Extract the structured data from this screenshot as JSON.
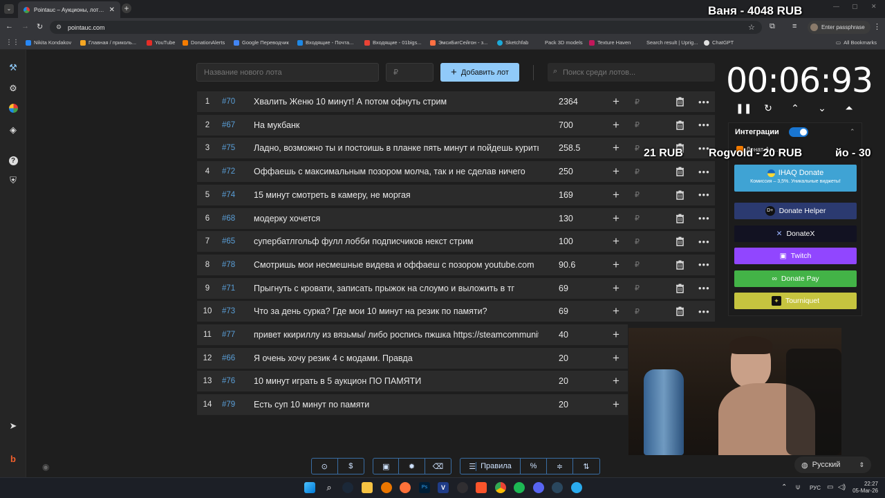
{
  "browser": {
    "tab_title": "Pointauc – Аукционы, лотереи",
    "url": "pointauc.com",
    "profile_label": "Enter passphrase",
    "bookmarks": [
      "Nikita Kondakov",
      "Главная / приколь...",
      "YouTube",
      "DonationAlerts",
      "Google Переводчик",
      "Входящие - Почта...",
      "Входящие - 01bigs...",
      "ЭмсиБигСейгон - з...",
      "Sketchfab",
      "Pack 3D models",
      "Texture Haven",
      "Search result | Uprig...",
      "ChatGPT"
    ],
    "all_bookmarks": "All Bookmarks"
  },
  "toolbar": {
    "new_lot_placeholder": "Название нового лота",
    "amount_placeholder": "₽",
    "add_button": "Добавить лот",
    "search_placeholder": "Поиск среди лотов..."
  },
  "lots": [
    {
      "rank": "1",
      "id": "#70",
      "name": "Хвалить Женю 10 минут! А потом офнуть стрим",
      "amount": "2364"
    },
    {
      "rank": "2",
      "id": "#67",
      "name": "На мукбанк",
      "amount": "700"
    },
    {
      "rank": "3",
      "id": "#75",
      "name": "Ладно, возможно ты и постоишь в планке пять минут и пойдешь курить",
      "amount": "258.5"
    },
    {
      "rank": "4",
      "id": "#72",
      "name": "Оффаешь с максимальным позором молча, так и не сделав ничего",
      "amount": "250"
    },
    {
      "rank": "5",
      "id": "#74",
      "name": "15 минут смотреть в камеру, не моргая",
      "amount": "169"
    },
    {
      "rank": "6",
      "id": "#68",
      "name": "модерку хочется",
      "amount": "130"
    },
    {
      "rank": "7",
      "id": "#65",
      "name": "супербатлгольф фулл лобби подписчиков некст стрим",
      "amount": "100"
    },
    {
      "rank": "8",
      "id": "#78",
      "name": "Смотришь мои несмешные видева и оффаеш с позором youtube.com",
      "amount": "90.6"
    },
    {
      "rank": "9",
      "id": "#71",
      "name": "Прыгнуть с кровати, записать прыжок на слоумо и выложить в тг",
      "amount": "69"
    },
    {
      "rank": "10",
      "id": "#73",
      "name": "Что за день сурка? Где мои 10 минут на резик по памяти?",
      "amount": "69"
    },
    {
      "rank": "11",
      "id": "#77",
      "name": "привет ккириллу из вязьмы/ либо роспись пжшка https://steamcommunity",
      "amount": "40"
    },
    {
      "rank": "12",
      "id": "#66",
      "name": "Я очень хочу резик 4 с модами. Правда",
      "amount": "20"
    },
    {
      "rank": "13",
      "id": "#76",
      "name": "10 минут играть в 5 аукцион ПО ПАМЯТИ",
      "amount": "20"
    },
    {
      "rank": "14",
      "id": "#79",
      "name": "Есть суп 10 минут по памяти",
      "amount": "20"
    }
  ],
  "row_plus": "+",
  "row_currency": "₽",
  "timer": "00:06:93",
  "integrations": {
    "title": "Интеграции",
    "ihaq_title": "IHAQ Donate",
    "ihaq_sub": "Комиссия – 3,5%. Уникальные виджеты!",
    "donate_helper": "Donate Helper",
    "donatex": "DonateX",
    "twitch": "Twitch",
    "donate_pay": "Donate Pay",
    "tourniquet": "Tourniquet",
    "partial_label": "Донат Ал..."
  },
  "overlay": {
    "top_donor": "Ваня - 4048 RUB",
    "ticker_1": "21 RUB",
    "ticker_2": "Rogvold - 20 RUB",
    "ticker_3": "йо - 30"
  },
  "bottom_toolbar": {
    "rules_label": "Правила",
    "language": "Русский"
  },
  "taskbar": {
    "lang_indicator": "РУС",
    "time": "22:27",
    "date": "05-Mar-26"
  },
  "colors": {
    "accent_blue": "#90caf9",
    "lot_id_blue": "#5a9fd8",
    "twitch": "#9146ff",
    "donate_pay": "#43b347",
    "tourniquet": "#c6c43f",
    "ihaq": "#3fa3d4",
    "donate_helper": "#2b3a70",
    "donatex": "#121222"
  }
}
